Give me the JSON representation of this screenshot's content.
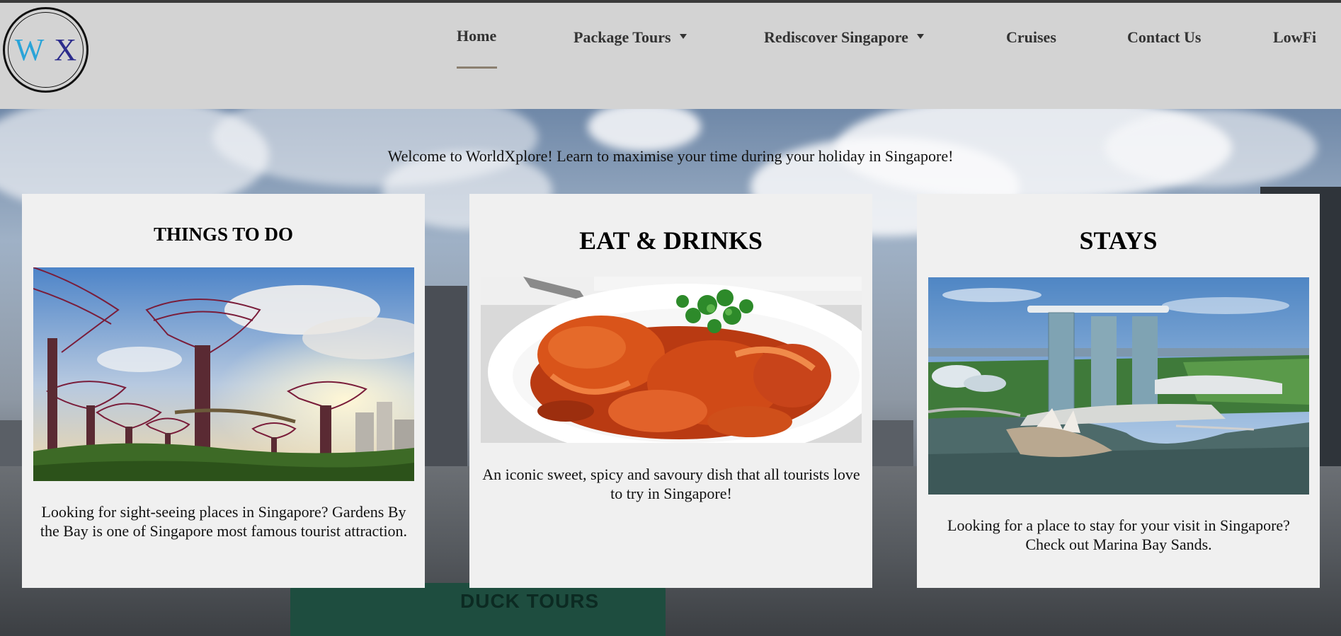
{
  "logo": {
    "left_letter": "W",
    "right_letter": "X"
  },
  "nav": {
    "items": [
      {
        "label": "Home",
        "active": true
      },
      {
        "label": "Package Tours",
        "dropdown": true
      },
      {
        "label": "Rediscover Singapore",
        "dropdown": true
      },
      {
        "label": "Cruises"
      },
      {
        "label": "Contact Us"
      },
      {
        "label": "LowFi"
      }
    ]
  },
  "hero": {
    "welcome": "Welcome to WorldXplore! Learn to maximise your time during your holiday in Singapore!",
    "boat_text": "DUCK TOURS"
  },
  "cards": [
    {
      "title": "THINGS TO DO",
      "image": "gardens-by-the-bay-supertrees",
      "text": "Looking for sight-seeing places in Singapore? Gardens By the Bay is one of Singapore most famous tourist attraction."
    },
    {
      "title": "EAT & DRINKS",
      "image": "chilli-crab-dish",
      "text": "An iconic sweet, spicy and savoury dish that all tourists love to try in Singapore!"
    },
    {
      "title": "STAYS",
      "image": "marina-bay-sands-aerial",
      "text": "Looking for a place to stay for your visit in Singapore? Check out Marina Bay Sands."
    }
  ],
  "colors": {
    "header_bg": "#d3d3d3",
    "card_bg": "#f0f0f0",
    "logo_w": "#2aa4d8",
    "logo_x": "#2c2c8c",
    "active_underline": "#8b7f70"
  }
}
